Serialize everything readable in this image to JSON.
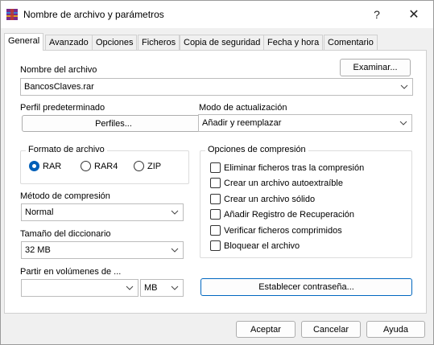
{
  "window": {
    "title": "Nombre de archivo y parámetros",
    "help": "?",
    "close": "✕"
  },
  "tabs": [
    "General",
    "Avanzado",
    "Opciones",
    "Ficheros",
    "Copia de seguridad",
    "Fecha y hora",
    "Comentario"
  ],
  "archive": {
    "label": "Nombre del archivo",
    "value": "BancosClaves.rar",
    "browse": "Examinar..."
  },
  "profile": {
    "label": "Perfil predeterminado",
    "button": "Perfiles..."
  },
  "update": {
    "label": "Modo de actualización",
    "value": "Añadir y reemplazar"
  },
  "format": {
    "title": "Formato de archivo",
    "options": [
      "RAR",
      "RAR4",
      "ZIP"
    ],
    "selected": "RAR"
  },
  "method": {
    "label": "Método de compresión",
    "value": "Normal"
  },
  "dictionary": {
    "label": "Tamaño del diccionario",
    "value": "32 MB"
  },
  "split": {
    "label": "Partir en volúmenes de ...",
    "value": "",
    "unit": "MB"
  },
  "compression_options": {
    "title": "Opciones de compresión",
    "items": [
      "Eliminar ficheros tras la compresión",
      "Crear un archivo autoextraíble",
      "Crear un archivo sólido",
      "Añadir Registro de Recuperación",
      "Verificar ficheros comprimidos",
      "Bloquear el archivo"
    ]
  },
  "password_button": "Establecer contraseña...",
  "footer": {
    "ok": "Aceptar",
    "cancel": "Cancelar",
    "help": "Ayuda"
  }
}
